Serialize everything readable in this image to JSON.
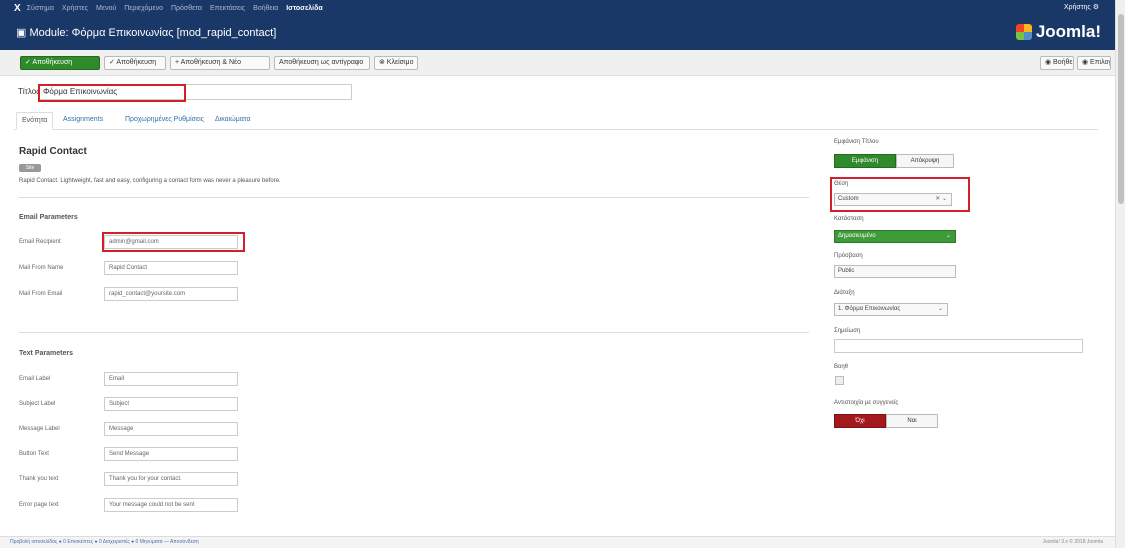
{
  "topnav": {
    "logo": "X",
    "items": [
      "Σύστημα",
      "Χρήστες",
      "Μενού",
      "Περιεχόμενο",
      "Πρόσθετα",
      "Επεκτάσεις",
      "Βοήθεια"
    ],
    "active_site": "Ιστοσελίδα",
    "user": "Χρήστης ⚙"
  },
  "header": {
    "title": "Module: Φόρμα Επικοινωνίας [mod_rapid_contact]",
    "brand": "Joomla!"
  },
  "toolbar": {
    "save": "✓ Αποθήκευση",
    "save_close": "✓ Αποθήκευση",
    "save_new": "+ Αποθήκευση & Νέο",
    "save_copy": "Αποθήκευση ως αντίγραφο",
    "close": "⊗ Κλείσιμο",
    "help": "◉ Βοήθεια",
    "options": "◉ Επιλογές"
  },
  "title_field": {
    "label": "Τίτλος*",
    "value": "Φόρμα Επικοινωνίας"
  },
  "tabs": [
    "Ενότητα",
    "Assignments",
    "Προχωρημένες Ρυθμίσεις",
    "Δικαιώματα"
  ],
  "module": {
    "name": "Rapid Contact",
    "badge": "Site",
    "description": "Rapid Contact. Lightweight, fast and easy, configuring a contact form was never a pleasure before."
  },
  "email_params": {
    "title": "Email Parameters",
    "fields": [
      {
        "label": "Email Recipient",
        "value": "admin@gmail.com"
      },
      {
        "label": "Mail From Name",
        "value": "Rapid Contact"
      },
      {
        "label": "Mail From Email",
        "value": "rapid_contact@yoursite.com"
      }
    ]
  },
  "text_params": {
    "title": "Text Parameters",
    "fields": [
      {
        "label": "Email Label",
        "value": "Email"
      },
      {
        "label": "Subject Label",
        "value": "Subject"
      },
      {
        "label": "Message Label",
        "value": "Message"
      },
      {
        "label": "Button Text",
        "value": "Send Message"
      },
      {
        "label": "Thank you text",
        "value": "Thank you for your contact."
      },
      {
        "label": "Error page text",
        "value": "Your message could not be sent"
      }
    ]
  },
  "right": {
    "show_title_label": "Εμφάνιση Τίτλου",
    "show_title_yes": "Εμφάνιση",
    "show_title_no": "Απόκρυψη",
    "position_label": "Θέση",
    "position_value": "Custom",
    "status_label": "Κατάσταση",
    "status_value": "Δημοσιευμένο",
    "access_label": "Πρόσβαση",
    "access_value": "Public",
    "ordering_label": "Διάταξη",
    "ordering_value": "1. Φόρμα Επικοινωνίας",
    "note_label": "Σημείωση",
    "feature_label": "Βοηθ",
    "sticky_label": "Αντιστοιχία με συγγενείς",
    "sticky_no": "Όχι",
    "sticky_yes": "Ναι"
  },
  "statusbar": {
    "links": "Προβολή ιστοσελίδας  ● 0 Επισκέπτες  ● 0 Διαχειριστές  ● 0 Μηνύματα  — Αποσύνδεση",
    "version": "Joomla! 3.x © 2018 Joomla"
  },
  "colors": {
    "nav_bg": "#1a3867",
    "save_green": "#2f8a2c",
    "highlight_red": "#d0202a",
    "no_red": "#a4191e"
  }
}
